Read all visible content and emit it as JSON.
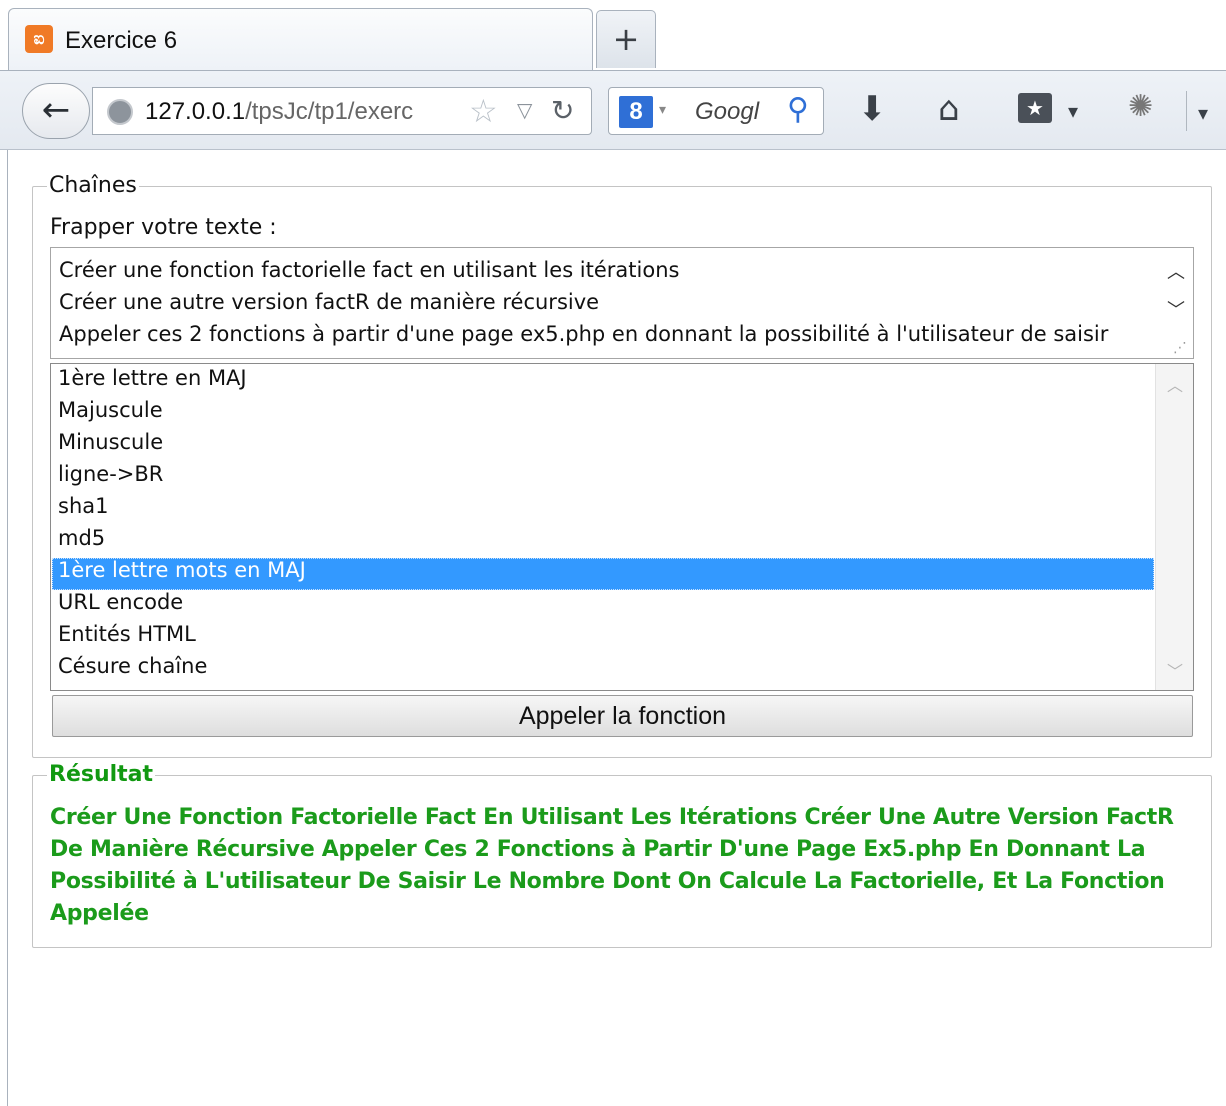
{
  "browser": {
    "tab_title": "Exercice 6",
    "tab_favicon": "xampp-icon",
    "new_tab_label": "+",
    "url_host": "127.0.0.1",
    "url_path": "/tpsJc/tp1/exerc",
    "search_placeholder": "Googl",
    "icons": [
      "back-arrow-icon",
      "globe-icon",
      "bookmark-star-icon",
      "history-dropdown-icon",
      "reload-icon",
      "google-icon",
      "search-icon",
      "download-icon",
      "home-icon",
      "bookmarks-icon",
      "extension-icon",
      "menu-dropdown-icon"
    ]
  },
  "form": {
    "legend": "Chaînes",
    "prompt": "Frapper votre texte :",
    "textarea_lines": [
      "Créer une fonction factorielle fact en utilisant les itérations",
      "Créer une autre version factR de manière récursive",
      "Appeler ces 2 fonctions à partir d'une page ex5.php en donnant la possibilité à l'utilisateur de saisir"
    ],
    "options": [
      "1ère lettre en MAJ",
      "Majuscule",
      "Minuscule",
      "ligne->BR",
      "sha1",
      "md5",
      "1ère lettre mots en MAJ",
      "URL encode",
      "Entités HTML",
      "Césure chaîne"
    ],
    "selected_option": "1ère lettre mots en MAJ",
    "submit_label": "Appeler la fonction"
  },
  "result": {
    "legend": "Résultat",
    "text": "Créer Une Fonction Factorielle Fact En Utilisant Les Itérations Créer Une Autre Version FactR De Manière Récursive Appeler Ces 2 Fonctions à Partir D'une Page Ex5.php En Donnant La Possibilité à L'utilisateur De Saisir Le Nombre Dont On Calcule La Factorielle, Et La Fonction Appelée",
    "color": "#1b9b1b"
  },
  "colors": {
    "selection": "#3399ff",
    "chrome": "#e4e9f0"
  }
}
